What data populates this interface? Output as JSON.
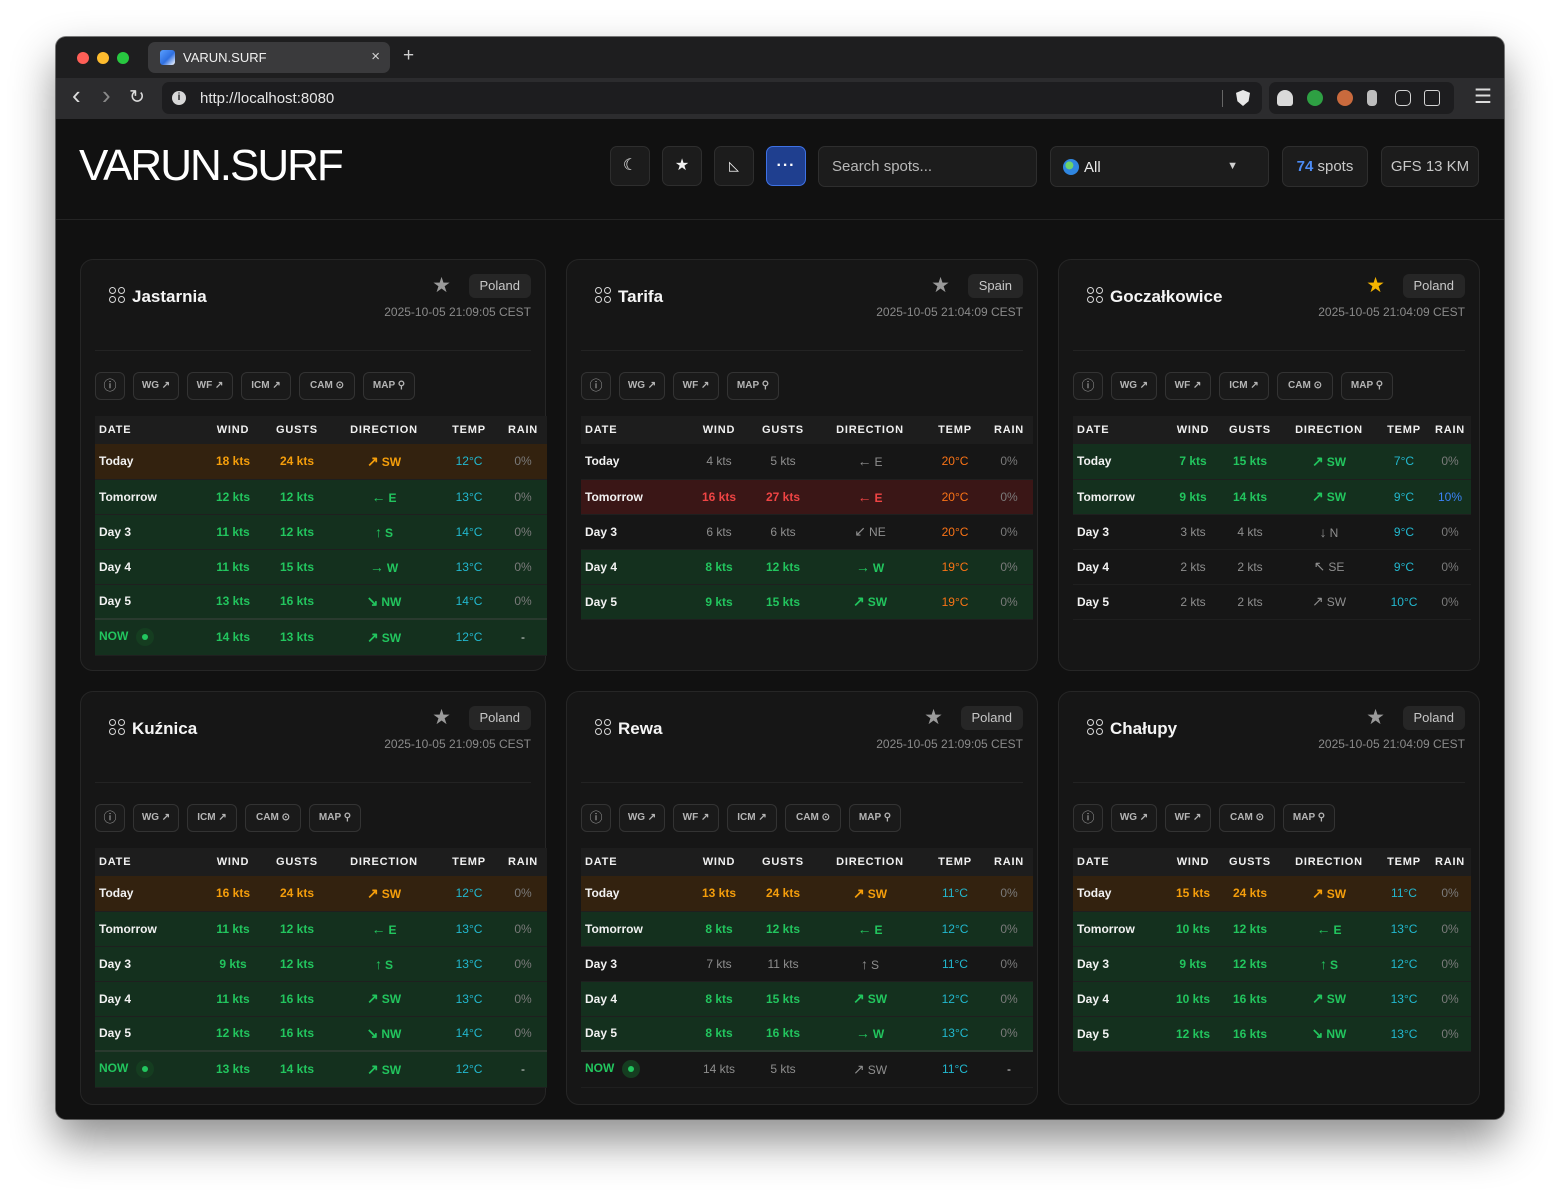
{
  "browser": {
    "tab_title": "VARUN.SURF",
    "tab_close": "×",
    "new_tab": "+",
    "back": "‹",
    "forward": "›",
    "reload": "↻",
    "url": "http://localhost:8080",
    "menu": "☰"
  },
  "app": {
    "logo": "VARUN.SURF",
    "buttons": {
      "theme_icon": "☾",
      "favorites_icon": "★",
      "sort_icon": "◺",
      "more_icon": "···"
    },
    "search_placeholder": "Search spots...",
    "country_filter": "All",
    "caret": "▼",
    "spots_count": "74",
    "spots_label": "spots",
    "model": "GFS 13 KM"
  },
  "table_headers": [
    "DATE",
    "WIND",
    "GUSTS",
    "DIRECTION",
    "TEMP",
    "RAIN"
  ],
  "cards": [
    {
      "name": "Jastarnia",
      "favorite": false,
      "star": "★",
      "country": "Poland",
      "timestamp": "2025-10-05 21:09:05 CEST",
      "links": [
        "ⓘ",
        "WG ↗",
        "WF ↗",
        "ICM ↗",
        "CAM ⊙",
        "MAP ⚲"
      ],
      "rows": [
        {
          "date": "Today",
          "wind": "18 kts",
          "gusts": "24 kts",
          "arrow": "↗",
          "dir": "SW",
          "temp": "12°C",
          "rain": "0%",
          "level": "o",
          "temp_style": "c",
          "rain_style": "n"
        },
        {
          "date": "Tomorrow",
          "wind": "12 kts",
          "gusts": "12 kts",
          "arrow": "←",
          "dir": "E",
          "temp": "13°C",
          "rain": "0%",
          "level": "g",
          "temp_style": "c",
          "rain_style": "n"
        },
        {
          "date": "Day 3",
          "wind": "11 kts",
          "gusts": "12 kts",
          "arrow": "↑",
          "dir": "S",
          "temp": "14°C",
          "rain": "0%",
          "level": "g",
          "temp_style": "c",
          "rain_style": "n"
        },
        {
          "date": "Day 4",
          "wind": "11 kts",
          "gusts": "15 kts",
          "arrow": "→",
          "dir": "W",
          "temp": "13°C",
          "rain": "0%",
          "level": "g",
          "temp_style": "c",
          "rain_style": "n"
        },
        {
          "date": "Day 5",
          "wind": "13 kts",
          "gusts": "16 kts",
          "arrow": "↘",
          "dir": "NW",
          "temp": "14°C",
          "rain": "0%",
          "level": "g",
          "temp_style": "c",
          "rain_style": "n"
        }
      ],
      "now": {
        "date": "NOW",
        "wind": "14 kts",
        "gusts": "13 kts",
        "arrow": "↗",
        "dir": "SW",
        "temp": "12°C",
        "rain": "-",
        "level": "g"
      }
    },
    {
      "name": "Tarifa",
      "favorite": false,
      "star": "★",
      "country": "Spain",
      "timestamp": "2025-10-05 21:04:09 CEST",
      "links": [
        "ⓘ",
        "WG ↗",
        "WF ↗",
        "MAP ⚲"
      ],
      "rows": [
        {
          "date": "Today",
          "wind": "4 kts",
          "gusts": "5 kts",
          "arrow": "←",
          "dir": "E",
          "temp": "20°C",
          "rain": "0%",
          "level": "n",
          "temp_style": "w",
          "rain_style": "n"
        },
        {
          "date": "Tomorrow",
          "wind": "16 kts",
          "gusts": "27 kts",
          "arrow": "←",
          "dir": "E",
          "temp": "20°C",
          "rain": "0%",
          "level": "r",
          "temp_style": "w",
          "rain_style": "n"
        },
        {
          "date": "Day 3",
          "wind": "6 kts",
          "gusts": "6 kts",
          "arrow": "↙",
          "dir": "NE",
          "temp": "20°C",
          "rain": "0%",
          "level": "n",
          "temp_style": "w",
          "rain_style": "n"
        },
        {
          "date": "Day 4",
          "wind": "8 kts",
          "gusts": "12 kts",
          "arrow": "→",
          "dir": "W",
          "temp": "19°C",
          "rain": "0%",
          "level": "g",
          "temp_style": "w",
          "rain_style": "n"
        },
        {
          "date": "Day 5",
          "wind": "9 kts",
          "gusts": "15 kts",
          "arrow": "↗",
          "dir": "SW",
          "temp": "19°C",
          "rain": "0%",
          "level": "g",
          "temp_style": "w",
          "rain_style": "n"
        }
      ]
    },
    {
      "name": "Goczałkowice",
      "favorite": true,
      "star": "★",
      "country": "Poland",
      "timestamp": "2025-10-05 21:04:09 CEST",
      "links": [
        "ⓘ",
        "WG ↗",
        "WF ↗",
        "ICM ↗",
        "CAM ⊙",
        "MAP ⚲"
      ],
      "rows": [
        {
          "date": "Today",
          "wind": "7 kts",
          "gusts": "15 kts",
          "arrow": "↗",
          "dir": "SW",
          "temp": "7°C",
          "rain": "0%",
          "level": "g",
          "temp_style": "c",
          "rain_style": "n"
        },
        {
          "date": "Tomorrow",
          "wind": "9 kts",
          "gusts": "14 kts",
          "arrow": "↗",
          "dir": "SW",
          "temp": "9°C",
          "rain": "10%",
          "level": "g",
          "temp_style": "c",
          "rain_style": "b"
        },
        {
          "date": "Day 3",
          "wind": "3 kts",
          "gusts": "4 kts",
          "arrow": "↓",
          "dir": "N",
          "temp": "9°C",
          "rain": "0%",
          "level": "n",
          "temp_style": "c",
          "rain_style": "n"
        },
        {
          "date": "Day 4",
          "wind": "2 kts",
          "gusts": "2 kts",
          "arrow": "↖",
          "dir": "SE",
          "temp": "9°C",
          "rain": "0%",
          "level": "n",
          "temp_style": "c",
          "rain_style": "n"
        },
        {
          "date": "Day 5",
          "wind": "2 kts",
          "gusts": "2 kts",
          "arrow": "↗",
          "dir": "SW",
          "temp": "10°C",
          "rain": "0%",
          "level": "n",
          "temp_style": "c",
          "rain_style": "n"
        }
      ]
    },
    {
      "name": "Kuźnica",
      "favorite": false,
      "star": "★",
      "country": "Poland",
      "timestamp": "2025-10-05 21:09:05 CEST",
      "links": [
        "ⓘ",
        "WG ↗",
        "ICM ↗",
        "CAM ⊙",
        "MAP ⚲"
      ],
      "rows": [
        {
          "date": "Today",
          "wind": "16 kts",
          "gusts": "24 kts",
          "arrow": "↗",
          "dir": "SW",
          "temp": "12°C",
          "rain": "0%",
          "level": "o",
          "temp_style": "c",
          "rain_style": "n"
        },
        {
          "date": "Tomorrow",
          "wind": "11 kts",
          "gusts": "12 kts",
          "arrow": "←",
          "dir": "E",
          "temp": "13°C",
          "rain": "0%",
          "level": "g",
          "temp_style": "c",
          "rain_style": "n"
        },
        {
          "date": "Day 3",
          "wind": "9 kts",
          "gusts": "12 kts",
          "arrow": "↑",
          "dir": "S",
          "temp": "13°C",
          "rain": "0%",
          "level": "g",
          "temp_style": "c",
          "rain_style": "n"
        },
        {
          "date": "Day 4",
          "wind": "11 kts",
          "gusts": "16 kts",
          "arrow": "↗",
          "dir": "SW",
          "temp": "13°C",
          "rain": "0%",
          "level": "g",
          "temp_style": "c",
          "rain_style": "n"
        },
        {
          "date": "Day 5",
          "wind": "12 kts",
          "gusts": "16 kts",
          "arrow": "↘",
          "dir": "NW",
          "temp": "14°C",
          "rain": "0%",
          "level": "g",
          "temp_style": "c",
          "rain_style": "n"
        }
      ],
      "now": {
        "date": "NOW",
        "wind": "13 kts",
        "gusts": "14 kts",
        "arrow": "↗",
        "dir": "SW",
        "temp": "12°C",
        "rain": "-",
        "level": "g"
      }
    },
    {
      "name": "Rewa",
      "favorite": false,
      "star": "★",
      "country": "Poland",
      "timestamp": "2025-10-05 21:09:05 CEST",
      "links": [
        "ⓘ",
        "WG ↗",
        "WF ↗",
        "ICM ↗",
        "CAM ⊙",
        "MAP ⚲"
      ],
      "rows": [
        {
          "date": "Today",
          "wind": "13 kts",
          "gusts": "24 kts",
          "arrow": "↗",
          "dir": "SW",
          "temp": "11°C",
          "rain": "0%",
          "level": "o",
          "temp_style": "c",
          "rain_style": "n"
        },
        {
          "date": "Tomorrow",
          "wind": "8 kts",
          "gusts": "12 kts",
          "arrow": "←",
          "dir": "E",
          "temp": "12°C",
          "rain": "0%",
          "level": "g",
          "temp_style": "c",
          "rain_style": "n"
        },
        {
          "date": "Day 3",
          "wind": "7 kts",
          "gusts": "11 kts",
          "arrow": "↑",
          "dir": "S",
          "temp": "11°C",
          "rain": "0%",
          "level": "n",
          "temp_style": "c",
          "rain_style": "n"
        },
        {
          "date": "Day 4",
          "wind": "8 kts",
          "gusts": "15 kts",
          "arrow": "↗",
          "dir": "SW",
          "temp": "12°C",
          "rain": "0%",
          "level": "g",
          "temp_style": "c",
          "rain_style": "n"
        },
        {
          "date": "Day 5",
          "wind": "8 kts",
          "gusts": "16 kts",
          "arrow": "→",
          "dir": "W",
          "temp": "13°C",
          "rain": "0%",
          "level": "g",
          "temp_style": "c",
          "rain_style": "n"
        }
      ],
      "now": {
        "date": "NOW",
        "wind": "14 kts",
        "gusts": "5 kts",
        "arrow": "↗",
        "dir": "SW",
        "temp": "11°C",
        "rain": "-",
        "level": "n"
      }
    },
    {
      "name": "Chałupy",
      "favorite": false,
      "star": "★",
      "country": "Poland",
      "timestamp": "2025-10-05 21:04:09 CEST",
      "links": [
        "ⓘ",
        "WG ↗",
        "WF ↗",
        "CAM ⊙",
        "MAP ⚲"
      ],
      "rows": [
        {
          "date": "Today",
          "wind": "15 kts",
          "gusts": "24 kts",
          "arrow": "↗",
          "dir": "SW",
          "temp": "11°C",
          "rain": "0%",
          "level": "o",
          "temp_style": "c",
          "rain_style": "n"
        },
        {
          "date": "Tomorrow",
          "wind": "10 kts",
          "gusts": "12 kts",
          "arrow": "←",
          "dir": "E",
          "temp": "13°C",
          "rain": "0%",
          "level": "g",
          "temp_style": "c",
          "rain_style": "n"
        },
        {
          "date": "Day 3",
          "wind": "9 kts",
          "gusts": "12 kts",
          "arrow": "↑",
          "dir": "S",
          "temp": "12°C",
          "rain": "0%",
          "level": "g",
          "temp_style": "c",
          "rain_style": "n"
        },
        {
          "date": "Day 4",
          "wind": "10 kts",
          "gusts": "16 kts",
          "arrow": "↗",
          "dir": "SW",
          "temp": "13°C",
          "rain": "0%",
          "level": "g",
          "temp_style": "c",
          "rain_style": "n"
        },
        {
          "date": "Day 5",
          "wind": "12 kts",
          "gusts": "16 kts",
          "arrow": "↘",
          "dir": "NW",
          "temp": "13°C",
          "rain": "0%",
          "level": "g",
          "temp_style": "c",
          "rain_style": "n"
        }
      ]
    }
  ]
}
